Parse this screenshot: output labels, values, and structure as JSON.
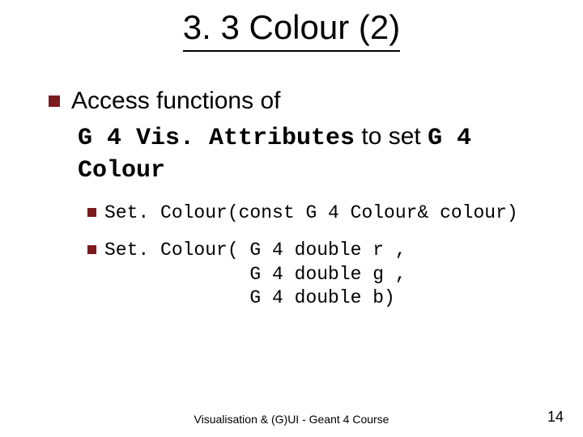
{
  "title": "3. 3 Colour (2)",
  "main": {
    "line1_plain": "Access functions of",
    "line2_code1": "G 4 Vis. Attributes",
    "line2_plain": " to set ",
    "line2_code2": "G 4 Colour",
    "sub": [
      "Set. Colour(const G 4 Colour& colour)",
      "Set. Colour( G 4 double r ,\n             G 4 double g ,\n             G 4 double b)"
    ]
  },
  "footer": {
    "center": "Visualisation & (G)UI - Geant 4 Course",
    "page": "14"
  }
}
